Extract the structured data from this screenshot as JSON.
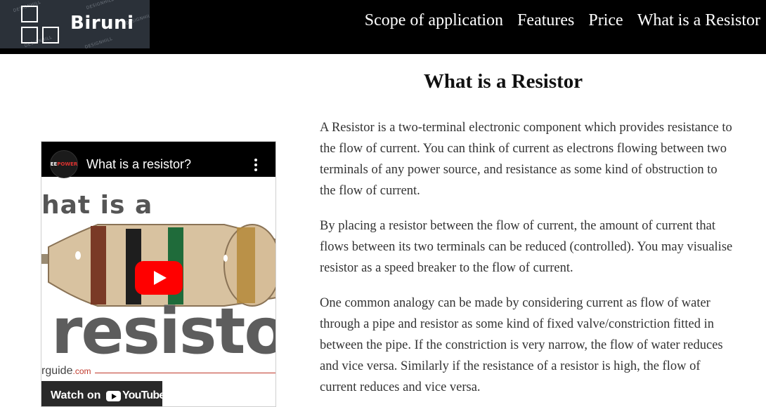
{
  "header": {
    "logo_text": "Biruni",
    "logo_watermark": "DESIGNHILL",
    "nav": [
      {
        "label": "Scope of application"
      },
      {
        "label": "Features"
      },
      {
        "label": "Price"
      },
      {
        "label": "What is a Resistor"
      }
    ]
  },
  "main": {
    "title": "What is a Resistor",
    "paragraphs": [
      "A Resistor is a two-terminal electronic component which provides resistance to the flow of current. You can think of current as electrons flowing between two terminals of any power source, and resistance as some kind of obstruction to the flow of current.",
      "By placing a resistor between the flow of current, the amount of current that flows between its two terminals can be reduced (controlled). You may visualise resistor as a speed breaker to the flow of current.",
      "One common analogy can be made by considering current as flow of water through a pipe and resistor as some kind of fixed valve/constriction fitted in between the pipe. If the constriction is very narrow, the flow of water reduces and vice versa. Similarly if the resistance of a resistor is high, the flow of current reduces and vice versa."
    ]
  },
  "video": {
    "title": "What is a resistor?",
    "channel_badge_a": "EE",
    "channel_badge_b": "POWER",
    "thumb_text_top": "hat is a",
    "thumb_text_main": "resistor",
    "thumb_site": "rguide",
    "thumb_site_suffix": ".com",
    "watch_label": "Watch on",
    "youtube_label": "YouTube"
  },
  "colors": {
    "header_bg": "#000000",
    "logo_bg": "#2b3139",
    "play_button": "#ff0000",
    "resistor_body": "#d8c2a0"
  }
}
